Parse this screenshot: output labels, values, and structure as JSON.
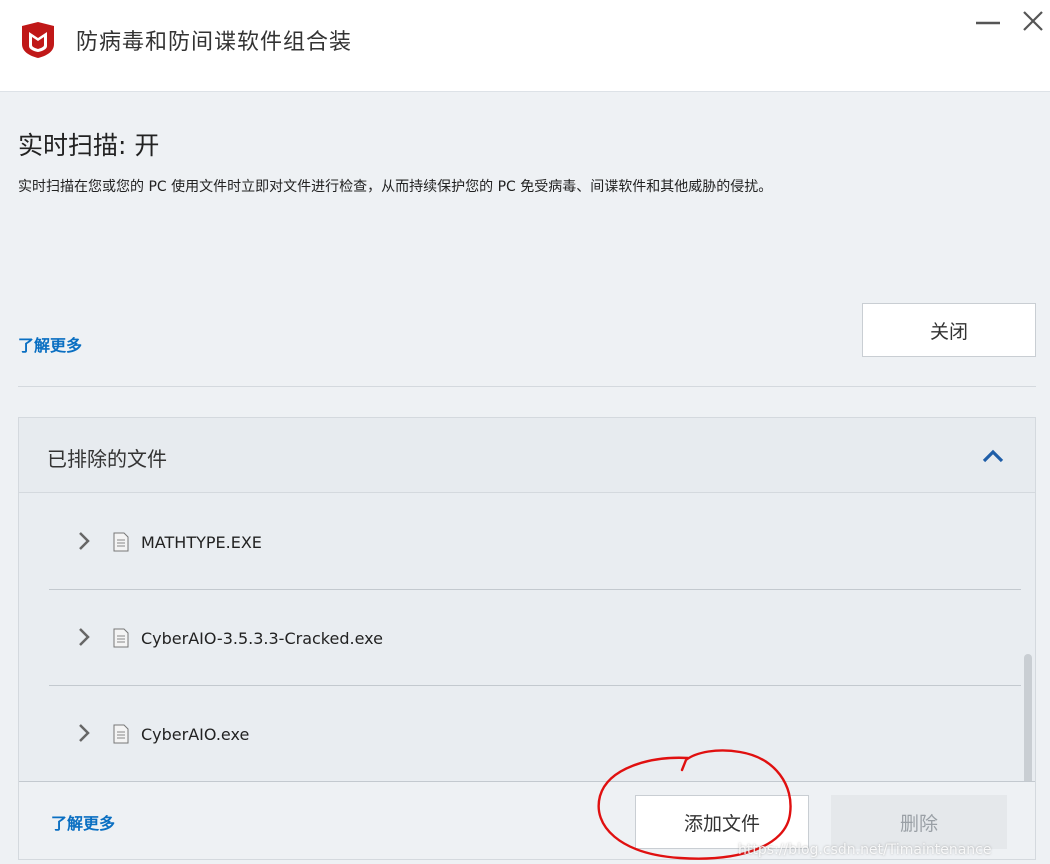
{
  "window": {
    "title": "防病毒和防间谍软件组合装",
    "brand_color": "#c01818"
  },
  "scan": {
    "title": "实时扫描: 开",
    "description": "实时扫描在您或您的 PC 使用文件时立即对文件进行检查，从而持续保护您的 PC 免受病毒、间谍软件和其他威胁的侵扰。",
    "learn_more": "了解更多",
    "close_label": "关闭"
  },
  "excluded": {
    "title": "已排除的文件",
    "files": [
      {
        "name": "MATHTYPE.EXE"
      },
      {
        "name": "CyberAIO-3.5.3.3-Cracked.exe"
      },
      {
        "name": "CyberAIO.exe"
      }
    ],
    "learn_more": "了解更多",
    "add_label": "添加文件",
    "delete_label": "删除"
  },
  "watermark": "https://blog.csdn.net/Timaintenance",
  "colors": {
    "link": "#0a6fc2",
    "chevron": "#1f5ea8",
    "annotation": "#e01010"
  }
}
